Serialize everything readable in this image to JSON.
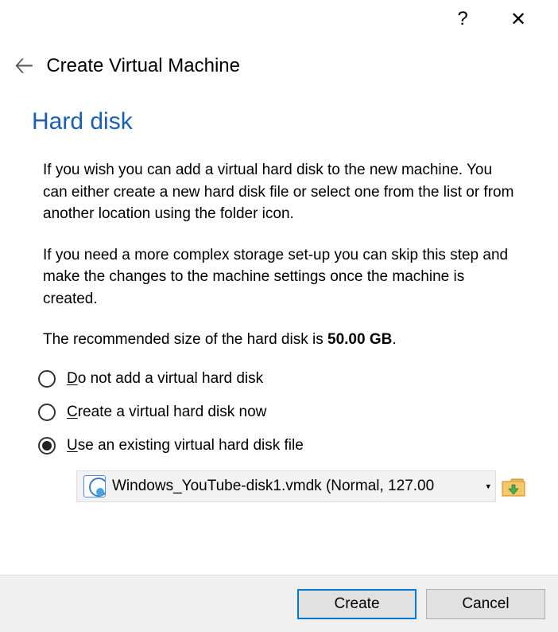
{
  "titlebar": {
    "help_glyph": "?",
    "close_glyph": "✕"
  },
  "header": {
    "back_glyph": "🡠",
    "title": "Create Virtual Machine"
  },
  "main": {
    "section_title": "Hard disk",
    "para1": "If you wish you can add a virtual hard disk to the new machine. You can either create a new hard disk file or select one from the list or from another location using the folder icon.",
    "para2": "If you need a more complex storage set-up you can skip this step and make the changes to the machine settings once the machine is created.",
    "para3_prefix": "The recommended size of the hard disk is ",
    "para3_bold": "50.00 GB",
    "para3_suffix": ".",
    "radios": {
      "opt1_u": "D",
      "opt1_rest": "o not add a virtual hard disk",
      "opt2_u": "C",
      "opt2_rest": "reate a virtual hard disk now",
      "opt3_u": "U",
      "opt3_rest": "se an existing virtual hard disk file"
    },
    "selected_disk": "Windows_YouTube-disk1.vmdk (Normal, 127.00"
  },
  "footer": {
    "create_label": "Create",
    "cancel_label": "Cancel"
  }
}
